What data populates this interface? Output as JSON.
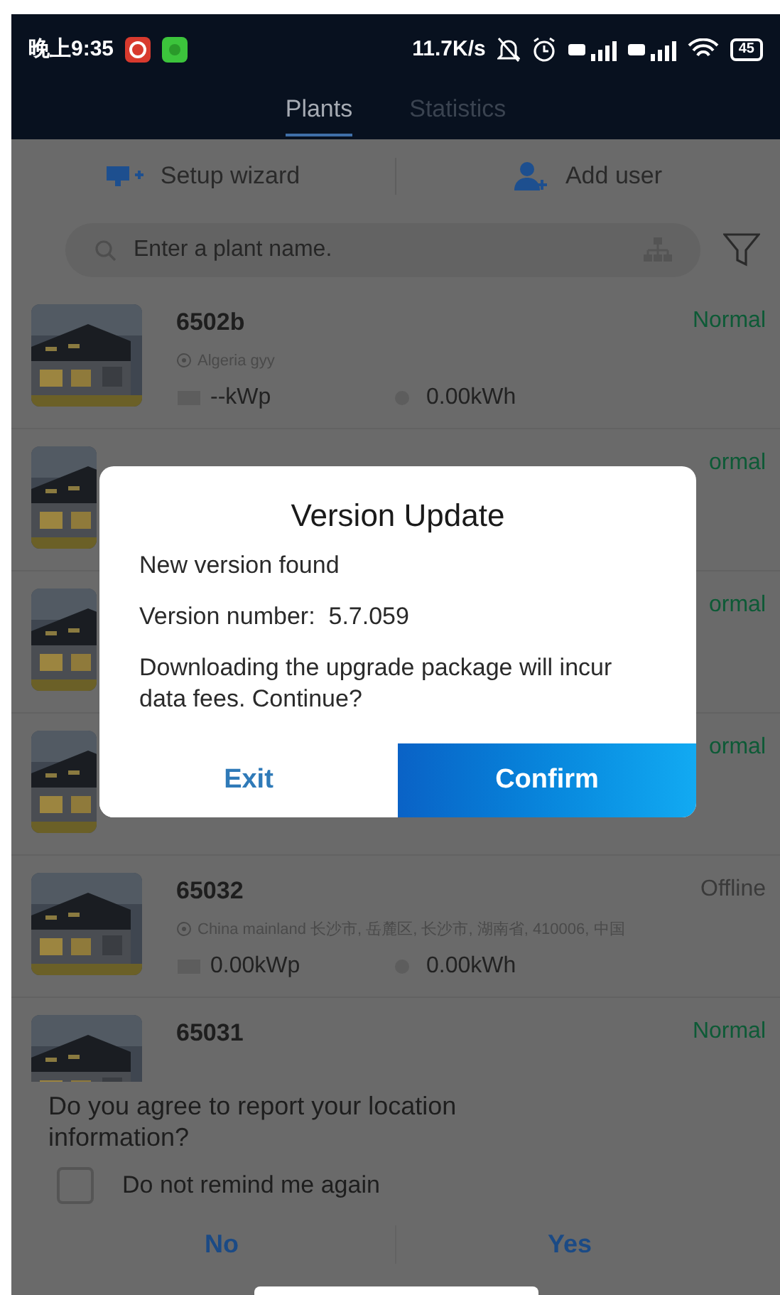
{
  "status_bar": {
    "time": "晚上9:35",
    "speed": "11.7K/s",
    "battery": "45"
  },
  "tabs": [
    {
      "label": "Plants",
      "selected": true
    },
    {
      "label": "Statistics",
      "selected": false
    }
  ],
  "toolbar": [
    {
      "label": "Setup wizard",
      "kind": "wizard"
    },
    {
      "label": "Add user",
      "kind": "user"
    }
  ],
  "search": {
    "placeholder": "Enter a plant name."
  },
  "plants": [
    {
      "name": "6502b",
      "location": "Algeria gyy",
      "capacity": "--kWp",
      "energy": "0.00kWh",
      "status": "Normal",
      "color": "#0d5a36"
    },
    {
      "status": "ormal",
      "color": "#0d5a36"
    },
    {
      "status": "ormal",
      "color": "#0d5a36"
    },
    {
      "status": "ormal",
      "color": "#0d5a36"
    },
    {
      "name": "65032",
      "location": "China mainland 长沙市, 岳麓区, 长沙市, 湖南省, 410006, 中国",
      "capacity": "0.00kWp",
      "energy": "0.00kWh",
      "status": "Offline",
      "color": "#3a3a3a"
    },
    {
      "name": "65031",
      "status": "Normal",
      "color": "#0d5a36"
    }
  ],
  "dialog": {
    "title": "Version Update",
    "lines": [
      "New version found",
      "Version number:  5.7.059",
      "Downloading the upgrade package will incur data fees. Continue?"
    ],
    "buttons": [
      {
        "label": "Exit",
        "primary": false
      },
      {
        "label": "Confirm",
        "primary": true
      }
    ]
  },
  "location_sheet": {
    "question": "Do you agree to report your location information?",
    "checkbox": {
      "label": "Do not remind me again",
      "checked": false
    },
    "buttons": [
      "No",
      "Yes"
    ]
  }
}
